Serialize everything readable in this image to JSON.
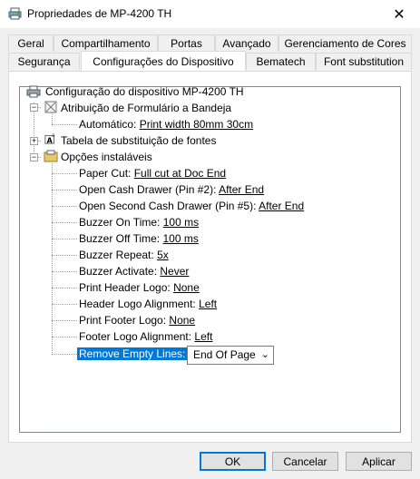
{
  "window": {
    "title": "Propriedades de MP-4200 TH",
    "close_symbol": "✕"
  },
  "tabs_row1": [
    "Geral",
    "Compartilhamento",
    "Portas",
    "Avançado",
    "Gerenciamento de Cores"
  ],
  "tabs_row2": [
    "Segurança",
    "Configurações do Dispositivo",
    "Bematech",
    "Font substitution"
  ],
  "active_tab": "Configurações do Dispositivo",
  "tree": {
    "root": "Configuração do dispositivo MP-4200 TH",
    "tray": {
      "label": "Atribuição de Formulário a Bandeja",
      "auto_label": "Automático:",
      "auto_value": "Print width 80mm 30cm"
    },
    "fonts": {
      "label": "Tabela de substituição de fontes",
      "expander": "+"
    },
    "options": {
      "label": "Opções instaláveis",
      "items": [
        {
          "label": "Paper Cut:",
          "value": "Full cut at Doc End"
        },
        {
          "label": "Open Cash Drawer (Pin #2):",
          "value": "After End"
        },
        {
          "label": "Open Second Cash Drawer (Pin #5):",
          "value": "After End"
        },
        {
          "label": "Buzzer On Time:",
          "value": "100 ms"
        },
        {
          "label": "Buzzer Off Time:",
          "value": "100 ms"
        },
        {
          "label": "Buzzer Repeat:",
          "value": "5x"
        },
        {
          "label": "Buzzer Activate:",
          "value": "Never"
        },
        {
          "label": "Print Header Logo:",
          "value": "None"
        },
        {
          "label": "Header Logo Alignment:",
          "value": "Left"
        },
        {
          "label": "Print Footer Logo:",
          "value": "None"
        },
        {
          "label": "Footer Logo Alignment:",
          "value": "Left"
        }
      ],
      "selected": {
        "label": "Remove Empty Lines:",
        "value": "End Of Page"
      }
    }
  },
  "buttons": {
    "ok": "OK",
    "cancel": "Cancelar",
    "apply": "Aplicar"
  }
}
